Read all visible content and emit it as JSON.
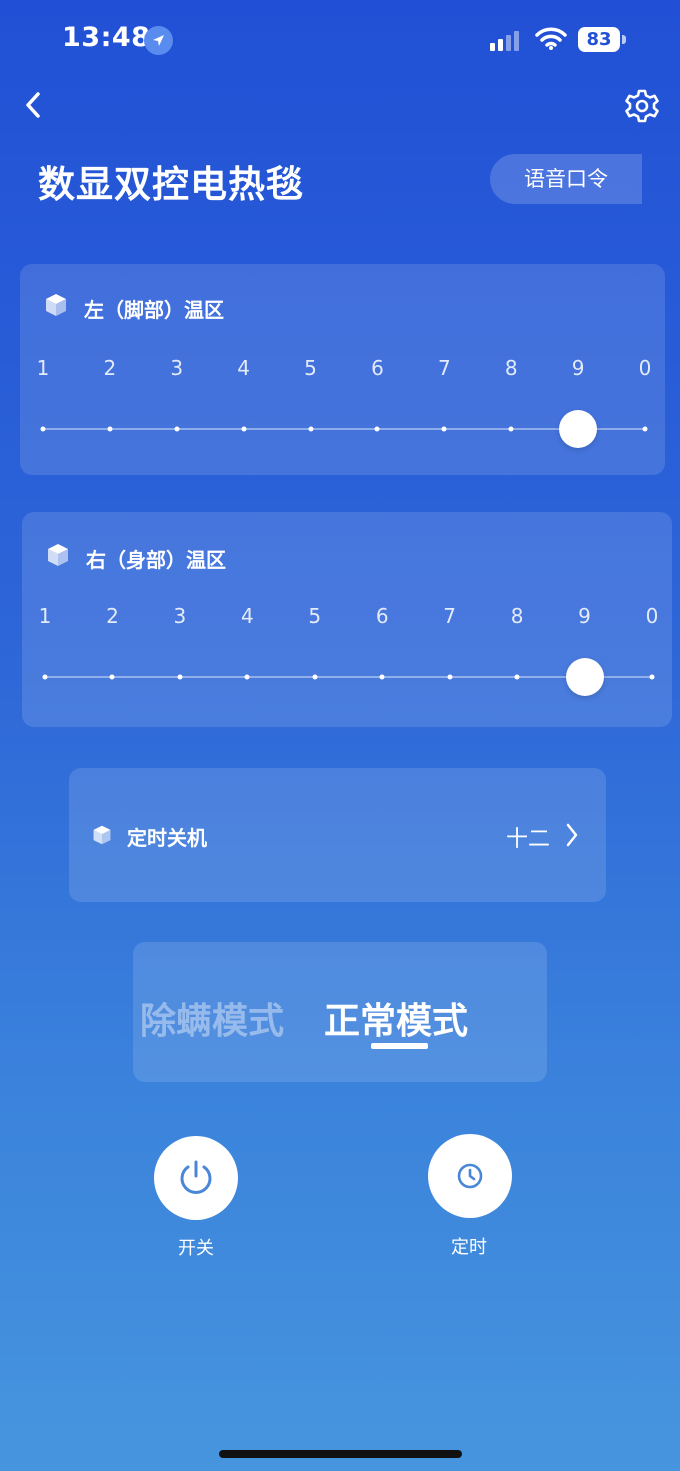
{
  "status_bar": {
    "time": "13:48",
    "battery": "83",
    "icons": [
      "location-arrow-icon",
      "cellular-signal-icon",
      "wifi-icon",
      "battery-icon"
    ]
  },
  "header": {
    "back_icon": "chevron-left-icon",
    "settings_icon": "gear-icon",
    "title": "数显双控电热毯",
    "voice_button": "语音口令"
  },
  "zones": [
    {
      "title": "左（脚部）温区",
      "icon": "cube-icon",
      "ticks": [
        "1",
        "2",
        "3",
        "4",
        "5",
        "6",
        "7",
        "8",
        "9",
        "0"
      ],
      "selected_index": 8
    },
    {
      "title": "右（身部）温区",
      "icon": "cube-icon",
      "ticks": [
        "1",
        "2",
        "3",
        "4",
        "5",
        "6",
        "7",
        "8",
        "9",
        "0"
      ],
      "selected_index": 8
    }
  ],
  "timer_off": {
    "icon": "cube-icon",
    "label": "定时关机",
    "value": "十二",
    "chevron": "chevron-right-icon"
  },
  "modes": {
    "items": [
      "除螨模式",
      "正常模式"
    ],
    "active": "正常模式"
  },
  "actions": [
    {
      "label": "开关",
      "icon": "power-icon"
    },
    {
      "label": "定时",
      "icon": "clock-icon"
    }
  ],
  "colors": {
    "background_top": "#2150d6",
    "background_bottom": "#4795de",
    "icon_accent": "#4a86d8"
  }
}
